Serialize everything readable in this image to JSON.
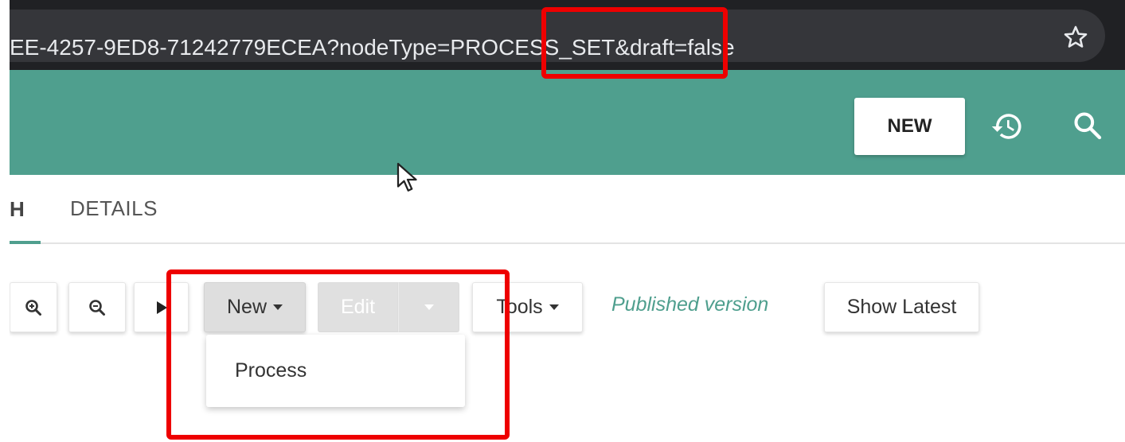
{
  "browser": {
    "url_text": "EE-4257-9ED8-71242779ECEA?nodeType=PROCESS_SET&draft=false",
    "bookmark_icon": "star-icon"
  },
  "header": {
    "new_button_label": "NEW",
    "history_icon": "history-icon",
    "search_icon": "search-icon",
    "color": "#4f9f8e"
  },
  "tabs": {
    "first_tab_fragment": "H",
    "details_label": "DETAILS"
  },
  "toolbar": {
    "zoom_in_icon": "zoom-in-icon",
    "zoom_out_icon": "zoom-out-icon",
    "play_icon": "play-icon",
    "new_label": "New",
    "edit_label": "Edit",
    "tools_label": "Tools",
    "published_label": "Published version",
    "show_latest_label": "Show Latest"
  },
  "new_menu": {
    "items": [
      {
        "label": "Process"
      }
    ]
  },
  "annotation_color": "#ee0000"
}
